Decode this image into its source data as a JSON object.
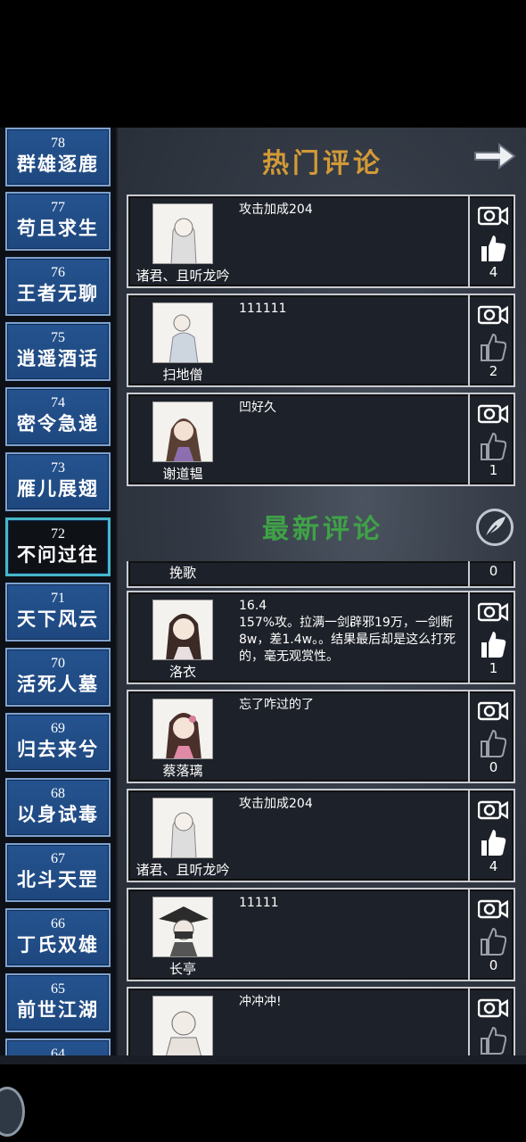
{
  "chapters": [
    {
      "num": "78",
      "name": "群雄逐鹿"
    },
    {
      "num": "77",
      "name": "苟且求生"
    },
    {
      "num": "76",
      "name": "王者无聊"
    },
    {
      "num": "75",
      "name": "逍遥酒话"
    },
    {
      "num": "74",
      "name": "密令急递"
    },
    {
      "num": "73",
      "name": "雁儿展翅"
    },
    {
      "num": "72",
      "name": "不问过往"
    },
    {
      "num": "71",
      "name": "天下风云"
    },
    {
      "num": "70",
      "name": "活死人墓"
    },
    {
      "num": "69",
      "name": "归去来兮"
    },
    {
      "num": "68",
      "name": "以身试毒"
    },
    {
      "num": "67",
      "name": "北斗天罡"
    },
    {
      "num": "66",
      "name": "丁氏双雄"
    },
    {
      "num": "65",
      "name": "前世江湖"
    },
    {
      "num": "64",
      "name": ""
    }
  ],
  "hot": {
    "title": "热门评论",
    "comments": [
      {
        "user": "诸君、且听龙吟",
        "text": "攻击加成204",
        "likes": "4",
        "liked": true
      },
      {
        "user": "扫地僧",
        "text": "111111",
        "likes": "2",
        "liked": false
      },
      {
        "user": "谢道韫",
        "text": "凹好久",
        "likes": "1",
        "liked": false
      }
    ]
  },
  "latest": {
    "title": "最新评论",
    "partial": {
      "user": "挽歌",
      "likes": "0"
    },
    "comments": [
      {
        "user": "洛衣",
        "text": "16.4\n157%攻。拉满一剑辟邪19万，一剑断8w，差1.4w。。结果最后却是这么打死的，毫无观赏性。",
        "likes": "1",
        "liked": true
      },
      {
        "user": "蔡落璃",
        "text": "忘了咋过的了",
        "likes": "0",
        "liked": false
      },
      {
        "user": "诸君、且听龙吟",
        "text": "攻击加成204",
        "likes": "4",
        "liked": true
      },
      {
        "user": "长亭",
        "text": "11111",
        "likes": "0",
        "liked": false
      },
      {
        "user": "",
        "text": "冲冲冲!",
        "likes": "",
        "liked": false
      }
    ]
  }
}
